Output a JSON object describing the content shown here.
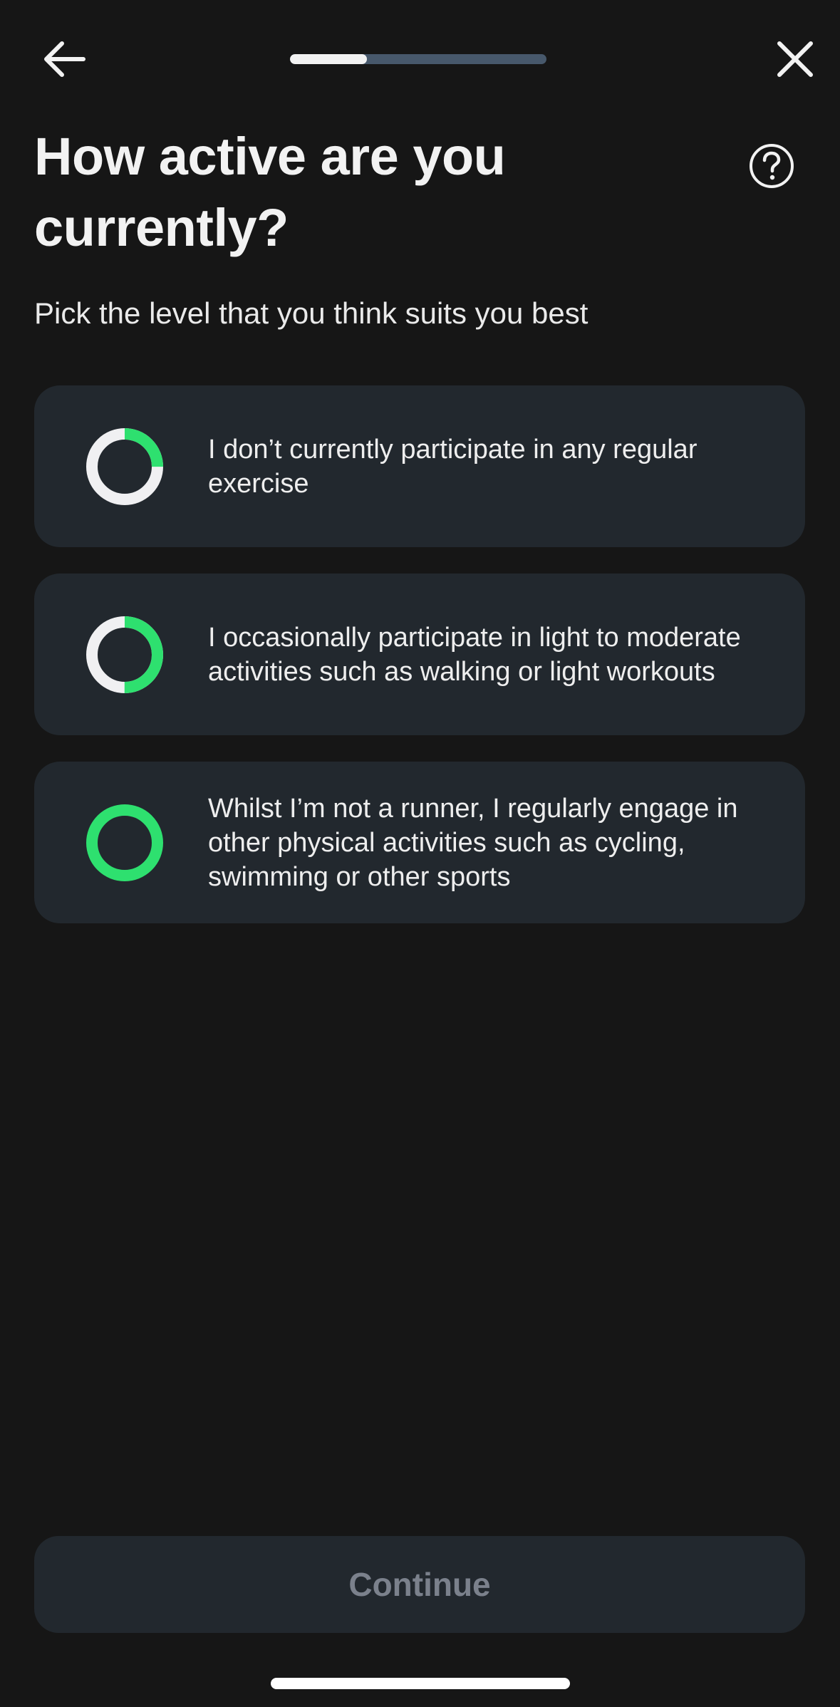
{
  "progress": {
    "value": 0.3
  },
  "header": {
    "title": "How active are you currently?",
    "subtitle": "Pick the level that you think suits you best"
  },
  "options": [
    {
      "label": "I don’t currently participate in any regular exercise",
      "level": 0.25
    },
    {
      "label": "I occasionally participate in light to moderate activities such as walking or light workouts",
      "level": 0.5
    },
    {
      "label": "Whilst I’m not a runner, I regularly engage in other physical activities such as cycling, swimming or other sports",
      "level": 1.0
    }
  ],
  "footer": {
    "continue_label": "Continue"
  },
  "colors": {
    "accent": "#2ee06f",
    "ring_base": "#f0f0f2",
    "card": "#22282e",
    "background": "#161616"
  }
}
